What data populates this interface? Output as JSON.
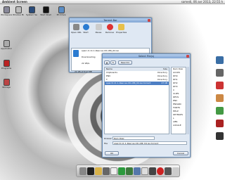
{
  "topbar": {
    "title": "Ambient Screen",
    "clock": "samedi, 06 avr 2013, 22:55 h"
  },
  "desktop": {
    "top_icons": [
      {
        "name": "workspace-icon",
        "label": "Workspace"
      },
      {
        "name": "window-manager-icon",
        "label": "Window Manager"
      },
      {
        "name": "system-settings-icon",
        "label": "System Settings"
      },
      {
        "name": "start-shell-icon",
        "label": "Start Shell"
      },
      {
        "name": "pc-drive-icon",
        "label": "PC Drive"
      }
    ],
    "left_icons": [
      {
        "name": "applications-icon",
        "label": "Applications"
      },
      {
        "name": "programs-icon",
        "label": "Programs"
      },
      {
        "name": "storage-icon",
        "label": "Storage"
      }
    ]
  },
  "torrent": {
    "title": "Torrent Bar",
    "tools": [
      "Open URL",
      "Start",
      "Pause",
      "Remove",
      "Properties"
    ],
    "download": {
      "name": "sparc-0.11.1-Rescue-CD-x86_64.iso",
      "status": "Downloading",
      "speed": "22 kB/s",
      "size": "22 kB of 512 MB"
    }
  },
  "select_file": {
    "title": "Select File(s)",
    "new_dir": "New Dir",
    "col_name": "Name",
    "col_size": "Size",
    "entries": [
      {
        "name": "Clipboards",
        "size": "Directory"
      },
      {
        "name": "ENV",
        "size": "Directory"
      },
      {
        "name": "T",
        "size": "Directory"
      },
      {
        "name": "sparc0.11.1-Rescue-CD-x86_64.iso.torrent",
        "size": "47 kB"
      }
    ],
    "volumes": [
      "Ram Disk",
      "AmiOS",
      "DH0",
      "DH1",
      "DH2",
      "DH3",
      "C",
      "CLIPS",
      "DEVS",
      "ENV",
      "ENVARC",
      "FONTS",
      "HELP",
      "KEYMAPS",
      "L",
      "LIBS",
      "LOCALE"
    ],
    "drawer_label": "Drawer",
    "drawer_value": "Ram Disk:",
    "file_label": "File",
    "file_value": "sparc0.11.1-Rescue-CD-x86_64.iso.torrent",
    "ok": "OK",
    "cancel": "Cancel"
  },
  "dock": {
    "items": [
      "settings",
      "shell",
      "paint",
      "gear",
      "filer",
      "clock",
      "editor",
      "tools",
      "mail",
      "media",
      "record",
      "prefs",
      "arrow"
    ]
  },
  "right_dock": [
    "browser",
    "mail",
    "player",
    "user",
    "photos",
    "chat",
    "terminal"
  ]
}
